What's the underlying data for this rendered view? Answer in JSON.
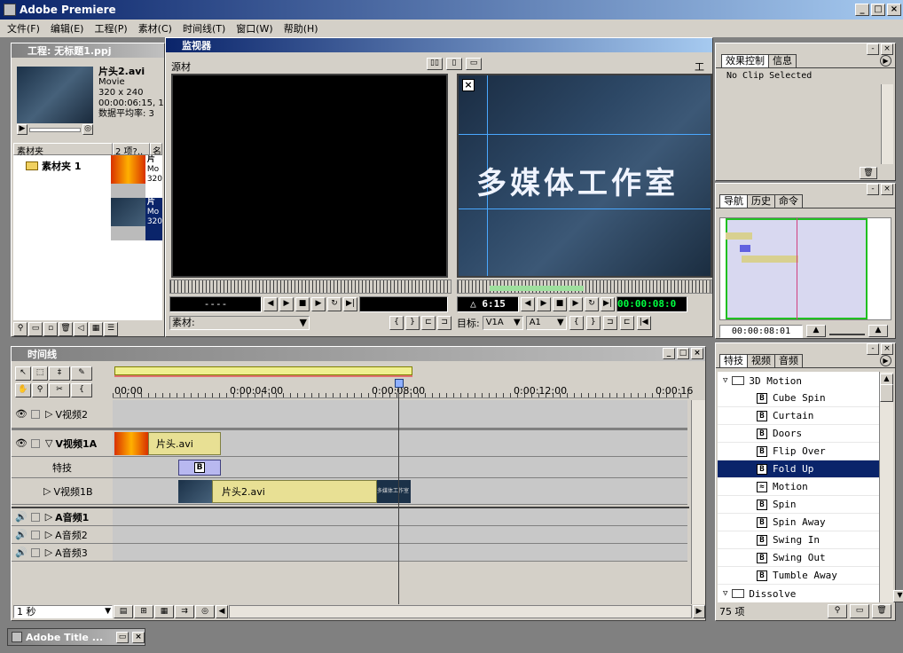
{
  "app": {
    "title": "Adobe Premiere"
  },
  "menu": [
    "文件(F)",
    "编辑(E)",
    "工程(P)",
    "素材(C)",
    "时间线(T)",
    "窗口(W)",
    "帮助(H)"
  ],
  "project": {
    "title": "工程: 无标题1.ppj",
    "clip_name": "片头2.avi",
    "clip_type": "Movie",
    "clip_size": "320 x 240",
    "clip_time": "00:00:06:15, 1",
    "clip_rate": "数据平均率: 3",
    "col_bins": "素材夹",
    "col_items": "2 项?..",
    "col_name": "名",
    "bin_name": "素材夹 1",
    "item1_name": "片",
    "item1_type": "Mo",
    "item1_size": "320",
    "item2_name": "片",
    "item2_type": "Mo",
    "item2_size": "320"
  },
  "monitor": {
    "title": "监视器",
    "source_label": "源材",
    "program_label": "工程",
    "source_time": "----",
    "delta_time": "△ 6:15",
    "program_time": "00:00:08:0",
    "source_combo": "素材:",
    "target_label": "目标:",
    "v_target": "V1A",
    "a_target": "A1",
    "overlay_text": "多媒体工作室"
  },
  "effect_controls": {
    "tab1": "效果控制",
    "tab2": "信息",
    "status": "No Clip Selected"
  },
  "navigator": {
    "tab1": "导航",
    "tab2": "历史",
    "tab3": "命令",
    "time": "00:00:08:01"
  },
  "transitions": {
    "tab1": "特技",
    "tab2": "视频",
    "tab3": "音频",
    "folder1": "3D Motion",
    "items": [
      "Cube Spin",
      "Curtain",
      "Doors",
      "Flip Over",
      "Fold Up",
      "Motion",
      "Spin",
      "Spin Away",
      "Swing In",
      "Swing Out",
      "Tumble Away"
    ],
    "folder2": "Dissolve",
    "count": "75 项",
    "selected_index": 4
  },
  "timeline": {
    "title": "时间线",
    "ruler": [
      "00:00",
      "0:00:04:00",
      "0:00:08:00",
      "0:00:12:00",
      "0:00:16"
    ],
    "tracks": {
      "v2": "V视频2",
      "v1a": "V视频1A",
      "fx": "特技",
      "v1b": "V视频1B",
      "a1": "A音频1",
      "a2": "A音频2",
      "a3": "A音频3"
    },
    "clip_a": "片头.avi",
    "clip_b": "片头2.avi",
    "zoom": "1 秒",
    "thumb_text": "多媒体工作室"
  },
  "taskbar": {
    "item": "Adobe Title ..."
  }
}
